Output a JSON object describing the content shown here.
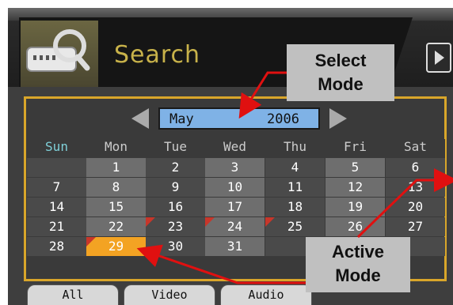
{
  "header": {
    "title": "Search",
    "search_icon": "dvr-search-icon",
    "next_icon": "next-page-icon"
  },
  "calendar": {
    "month": "May",
    "year": "2006",
    "weekdays": [
      "Sun",
      "Mon",
      "Tue",
      "Wed",
      "Thu",
      "Fri",
      "Sat"
    ],
    "weeks": [
      [
        "",
        "1",
        "2",
        "3",
        "4",
        "5",
        "6"
      ],
      [
        "7",
        "8",
        "9",
        "10",
        "11",
        "12",
        "13"
      ],
      [
        "14",
        "15",
        "16",
        "17",
        "18",
        "19",
        "20"
      ],
      [
        "21",
        "22",
        "23",
        "24",
        "25",
        "26",
        "27"
      ],
      [
        "28",
        "29",
        "30",
        "31",
        "",
        "",
        ""
      ]
    ],
    "selected_day": "29",
    "recorded_days": [
      "23",
      "24",
      "25",
      "29"
    ],
    "colors": {
      "frame": "#d9a62a",
      "selected": "#f3a323",
      "month_box": "#7fb2e6",
      "record_mark": "#c8362a"
    }
  },
  "filter_tabs": [
    "All",
    "Video",
    "Audio"
  ],
  "annotations": {
    "select_mode": [
      "Select",
      "Mode"
    ],
    "active_mode": [
      "Active",
      "Mode"
    ],
    "arrow_color": "#e01010"
  }
}
